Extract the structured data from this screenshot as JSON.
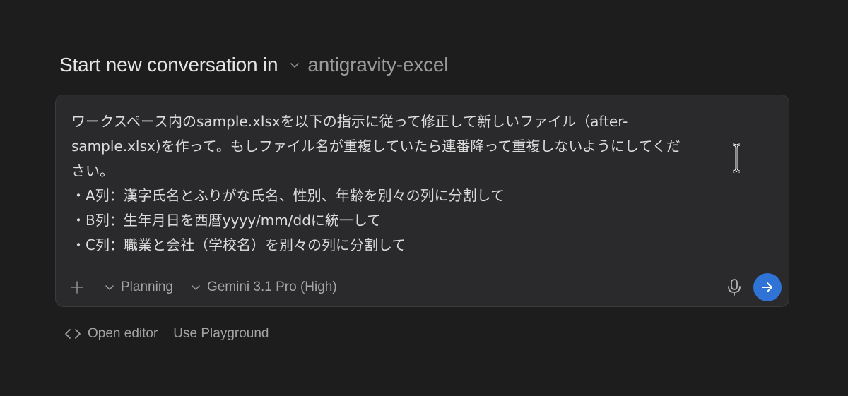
{
  "header": {
    "lead": "Start new conversation in",
    "workspace": "antigravity-excel"
  },
  "prompt": {
    "text": "ワークスペース内のsample.xlsxを以下の指示に従って修正して新しいファイル（after-\nsample.xlsx)を作って。もしファイル名が重複していたら連番降って重複しないようにしてくだ\nさい。\n・A列：漢字氏名とふりがな氏名、性別、年齢を別々の列に分割して\n・B列：生年月日を西暦yyyy/mm/ddに統一して\n・C列：職業と会社（学校名）を別々の列に分割して"
  },
  "toolbar": {
    "mode_label": "Planning",
    "model_label": "Gemini 3.1 Pro (High)"
  },
  "footer": {
    "open_editor_label": "Open editor",
    "playground_label": "Use Playground"
  },
  "icons": {
    "workspace_chevron": "chevron-down-icon",
    "add": "plus-icon",
    "mode_chevron": "chevron-down-icon",
    "model_chevron": "chevron-down-icon",
    "mic": "microphone-icon",
    "send": "arrow-right-icon",
    "code": "code-brackets-icon",
    "cursor": "text-cursor-icon"
  },
  "colors": {
    "background": "#1d1d1e",
    "panel": "#2a2a2c",
    "accent": "#2f73d6"
  }
}
